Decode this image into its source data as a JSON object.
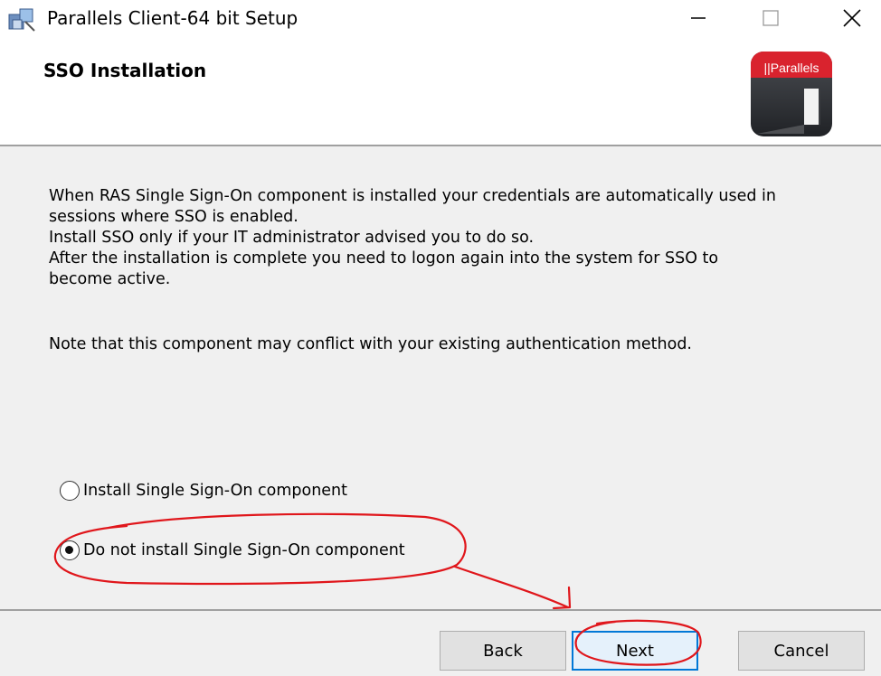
{
  "window": {
    "title": "Parallels Client-64 bit Setup",
    "icons": {
      "app": "installer-icon",
      "minimize": "minimize-icon",
      "maximize": "maximize-icon",
      "close": "close-icon"
    }
  },
  "header": {
    "title": "SSO Installation",
    "logo_text": "||Parallels"
  },
  "content": {
    "description_lines": [
      "When RAS Single Sign-On component is installed your credentials are automatically used in",
      "sessions where SSO is enabled.",
      "Install SSO only if your IT administrator advised you to do so.",
      "After the installation is complete you need to logon again into the system for SSO to",
      "become active."
    ],
    "note": "Note that this component may conflict with your existing authentication method."
  },
  "options": [
    {
      "label": "Install Single Sign-On component",
      "selected": false
    },
    {
      "label": "Do not install Single Sign-On component",
      "selected": true
    }
  ],
  "buttons": {
    "back": "Back",
    "next": "Next",
    "cancel": "Cancel"
  },
  "colors": {
    "panel": "#f0f0f0",
    "focus": "#0078d7",
    "annotation": "#e0161b",
    "brand_red": "#d9232e"
  }
}
